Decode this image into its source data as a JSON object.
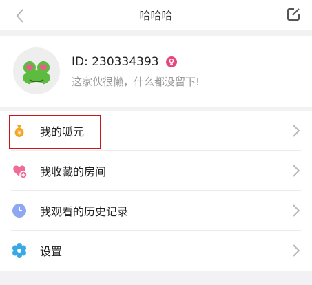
{
  "header": {
    "title": "哈哈哈"
  },
  "profile": {
    "id_text": "ID: 230334393",
    "bio": "这家伙很懒，什么都没留下!"
  },
  "menu": {
    "items": [
      {
        "label": "我的呱元",
        "icon": "money-bag-icon"
      },
      {
        "label": "我收藏的房间",
        "icon": "heart-plus-icon"
      },
      {
        "label": "我观看的历史记录",
        "icon": "clock-icon"
      },
      {
        "label": "设置",
        "icon": "gear-icon"
      }
    ]
  },
  "colors": {
    "accent_pink": "#e8457b",
    "highlight_red": "#c8161d",
    "coin_orange": "#f5a623",
    "clock_blue": "#8fa7f2",
    "gear_blue": "#39a9e6"
  }
}
